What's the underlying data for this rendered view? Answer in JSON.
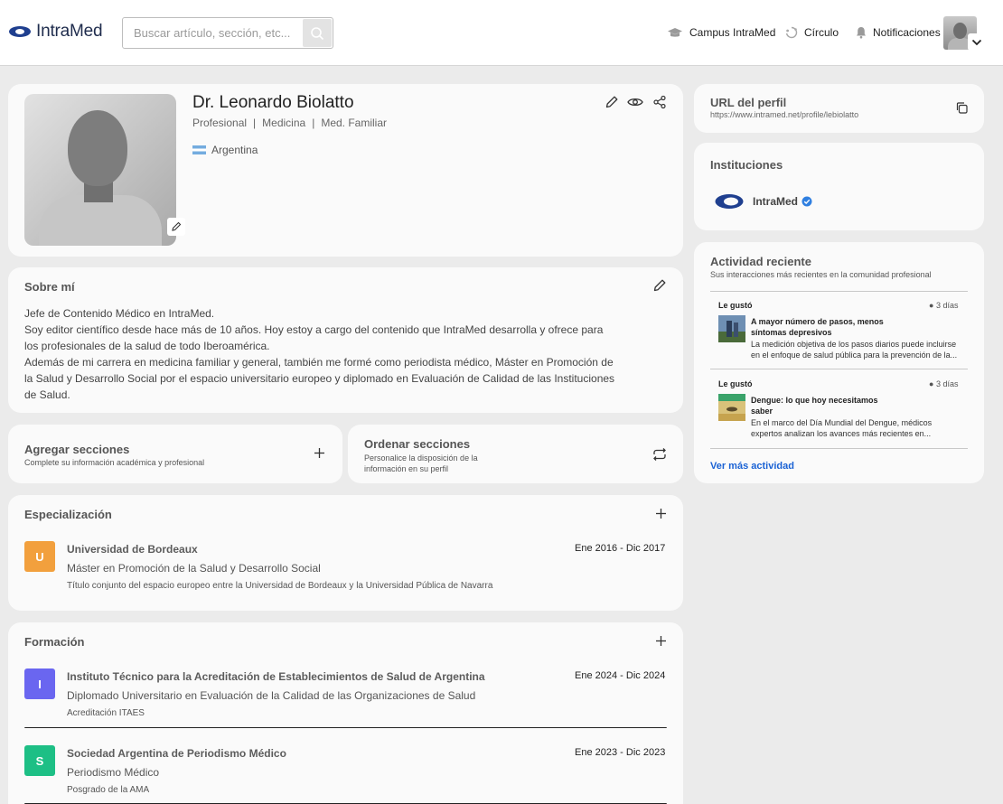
{
  "header": {
    "logo_text": "IntraMed",
    "search_placeholder": "Buscar artículo, sección, etc...",
    "nav": [
      {
        "label": "Campus IntraMed",
        "icon": "graduation-cap-icon"
      },
      {
        "label": "Círculo",
        "icon": "circle-icon"
      },
      {
        "label": "Notificaciones",
        "icon": "bell-icon"
      }
    ]
  },
  "profile": {
    "name": "Dr. Leonardo Biolatto",
    "role": "Profesional",
    "area": "Medicina",
    "specialty": "Med. Familiar",
    "separator": "|",
    "country": "Argentina"
  },
  "about": {
    "title": "Sobre mí",
    "lines": [
      "Jefe de Contenido Médico en IntraMed.",
      "Soy editor científico desde hace más de 10 años. Hoy estoy a cargo del contenido que IntraMed desarrolla y ofrece para",
      "los profesionales de la salud de todo Iberoamérica.",
      "Además de mi carrera en medicina familiar y general, también me formé como periodista médico, Máster en Promoción de",
      "la Salud y Desarrollo Social por el espacio universitario europeo y diplomado en Evaluación de Calidad de las Instituciones",
      "de Salud."
    ]
  },
  "add_sections": {
    "title": "Agregar secciones",
    "subtitle": "Complete su información académica y profesional"
  },
  "order_sections": {
    "title": "Ordenar secciones",
    "subtitle_1": "Personalice la disposición de la",
    "subtitle_2": "información en su perfil"
  },
  "specialization": {
    "title": "Especialización",
    "entries": [
      {
        "badge": "U",
        "color": "#f2a03d",
        "institution": "Universidad de Bordeaux",
        "degree": "Máster en Promoción de la Salud y Desarrollo Social",
        "note": "Título conjunto del espacio europeo entre la Universidad de Bordeaux y la Universidad Pública de Navarra",
        "start": "Ene 2016",
        "end": "Dic 2017"
      }
    ]
  },
  "education": {
    "title": "Formación",
    "entries": [
      {
        "badge": "I",
        "color": "#6a66f0",
        "institution": "Instituto Técnico para la Acreditación de Establecimientos de Salud de Argentina",
        "degree": "Diplomado Universitario en Evaluación de la Calidad de las Organizaciones de Salud",
        "note": "Acreditación ITAES",
        "start": "Ene 2024",
        "end": "Dic 2024"
      },
      {
        "badge": "S",
        "color": "#1dbf85",
        "institution": "Sociedad Argentina de Periodismo Médico",
        "degree": "Periodismo Médico",
        "note": "Posgrado de la AMA",
        "start": "Ene 2023",
        "end": "Dic 2023"
      }
    ]
  },
  "date_separator": "-",
  "profile_url": {
    "title": "URL del perfil",
    "url": "https://www.intramed.net/profile/lebiolatto"
  },
  "institutions": {
    "title": "Instituciones",
    "items": [
      {
        "name": "IntraMed",
        "verified": true
      }
    ]
  },
  "activity": {
    "title": "Actividad reciente",
    "subtitle": "Sus interacciones más recientes en la comunidad profesional",
    "items": [
      {
        "action": "Le gustó",
        "time": "3 días",
        "title_1": "A mayor número de pasos, menos",
        "title_2": "síntomas depresivos",
        "desc_1": "La medición objetiva de los pasos diarios puede incluirse",
        "desc_2": "en el enfoque de salud pública para la prevención de la..."
      },
      {
        "action": "Le gustó",
        "time": "3 días",
        "title_1": "Dengue: lo que hoy necesitamos",
        "title_2": "saber",
        "desc_1": "En el marco del Día Mundial del Dengue, médicos",
        "desc_2": "expertos analizan los avances más recientes en..."
      }
    ],
    "more_label": "Ver más actividad"
  },
  "colors": {
    "link": "#1a62d4",
    "verified": "#2f7fe0",
    "brand": "#1f3f8f"
  }
}
